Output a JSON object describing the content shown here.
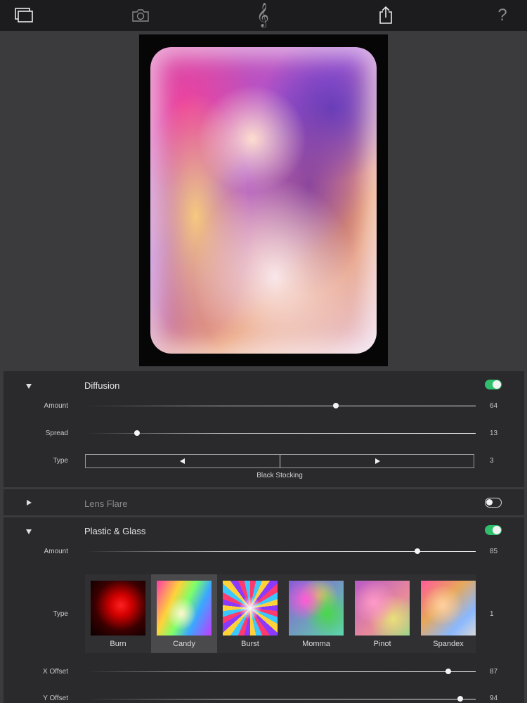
{
  "toolbar": {
    "icons": [
      "gallery-icon",
      "camera-icon",
      "treble-clef-icon",
      "share-icon",
      "help-icon"
    ],
    "help_label": "?"
  },
  "panels": {
    "diffusion": {
      "title": "Diffusion",
      "enabled": true,
      "amount": {
        "label": "Amount",
        "value": "64",
        "fraction": 0.64
      },
      "spread": {
        "label": "Spread",
        "value": "13",
        "fraction": 0.13
      },
      "type": {
        "label": "Type",
        "value": "3",
        "name": "Black Stocking"
      }
    },
    "lens_flare": {
      "title": "Lens Flare",
      "enabled": false
    },
    "plastic_glass": {
      "title": "Plastic & Glass",
      "enabled": true,
      "amount": {
        "label": "Amount",
        "value": "85",
        "fraction": 0.85
      },
      "type": {
        "label": "Type",
        "value": "1"
      },
      "presets": [
        {
          "name": "Burn",
          "selected": false
        },
        {
          "name": "Candy",
          "selected": true
        },
        {
          "name": "Burst",
          "selected": false
        },
        {
          "name": "Momma",
          "selected": false
        },
        {
          "name": "Pinot",
          "selected": false
        },
        {
          "name": "Spandex",
          "selected": false
        }
      ],
      "x_offset": {
        "label": "X Offset",
        "value": "87",
        "fraction": 0.93
      },
      "y_offset": {
        "label": "Y Offset",
        "value": "94",
        "fraction": 0.96
      }
    }
  },
  "colors": {
    "toggle_on": "#2fbe6c",
    "panel_bg": "#2a2a2c",
    "canvas_bg": "#3b3b3d",
    "toolbar_bg": "#1c1c1e"
  }
}
